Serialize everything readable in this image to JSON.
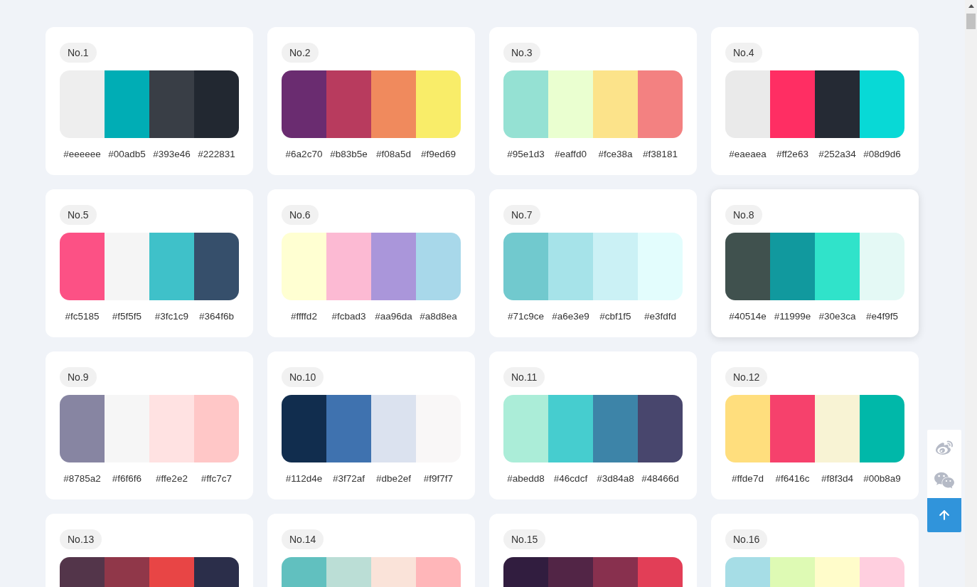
{
  "palettes": [
    {
      "label": "No.1",
      "highlighted": false,
      "swatches": [
        {
          "color": "#eeeeee",
          "hex": "#eeeeee"
        },
        {
          "color": "#00adb5",
          "hex": "#00adb5"
        },
        {
          "color": "#393e46",
          "hex": "#393e46"
        },
        {
          "color": "#222831",
          "hex": "#222831"
        }
      ]
    },
    {
      "label": "No.2",
      "highlighted": false,
      "swatches": [
        {
          "color": "#6a2c70",
          "hex": "#6a2c70"
        },
        {
          "color": "#b83b5e",
          "hex": "#b83b5e"
        },
        {
          "color": "#f08a5d",
          "hex": "#f08a5d"
        },
        {
          "color": "#f9ed69",
          "hex": "#f9ed69"
        }
      ]
    },
    {
      "label": "No.3",
      "highlighted": false,
      "swatches": [
        {
          "color": "#95e1d3",
          "hex": "#95e1d3"
        },
        {
          "color": "#eaffd0",
          "hex": "#eaffd0"
        },
        {
          "color": "#fce38a",
          "hex": "#fce38a"
        },
        {
          "color": "#f38181",
          "hex": "#f38181"
        }
      ]
    },
    {
      "label": "No.4",
      "highlighted": false,
      "swatches": [
        {
          "color": "#eaeaea",
          "hex": "#eaeaea"
        },
        {
          "color": "#ff2e63",
          "hex": "#ff2e63"
        },
        {
          "color": "#252a34",
          "hex": "#252a34"
        },
        {
          "color": "#08d9d6",
          "hex": "#08d9d6"
        }
      ]
    },
    {
      "label": "No.5",
      "highlighted": false,
      "swatches": [
        {
          "color": "#fc5185",
          "hex": "#fc5185"
        },
        {
          "color": "#f5f5f5",
          "hex": "#f5f5f5"
        },
        {
          "color": "#3fc1c9",
          "hex": "#3fc1c9"
        },
        {
          "color": "#364f6b",
          "hex": "#364f6b"
        }
      ]
    },
    {
      "label": "No.6",
      "highlighted": false,
      "swatches": [
        {
          "color": "#ffffd2",
          "hex": "#ffffd2"
        },
        {
          "color": "#fcbad3",
          "hex": "#fcbad3"
        },
        {
          "color": "#aa96da",
          "hex": "#aa96da"
        },
        {
          "color": "#a8d8ea",
          "hex": "#a8d8ea"
        }
      ]
    },
    {
      "label": "No.7",
      "highlighted": false,
      "swatches": [
        {
          "color": "#71c9ce",
          "hex": "#71c9ce"
        },
        {
          "color": "#a6e3e9",
          "hex": "#a6e3e9"
        },
        {
          "color": "#cbf1f5",
          "hex": "#cbf1f5"
        },
        {
          "color": "#e3fdfd",
          "hex": "#e3fdfd"
        }
      ]
    },
    {
      "label": "No.8",
      "highlighted": true,
      "swatches": [
        {
          "color": "#40514e",
          "hex": "#40514e"
        },
        {
          "color": "#11999e",
          "hex": "#11999e"
        },
        {
          "color": "#30e3ca",
          "hex": "#30e3ca"
        },
        {
          "color": "#e4f9f5",
          "hex": "#e4f9f5"
        }
      ]
    },
    {
      "label": "No.9",
      "highlighted": false,
      "swatches": [
        {
          "color": "#8785a2",
          "hex": "#8785a2"
        },
        {
          "color": "#f6f6f6",
          "hex": "#f6f6f6"
        },
        {
          "color": "#ffe2e2",
          "hex": "#ffe2e2"
        },
        {
          "color": "#ffc7c7",
          "hex": "#ffc7c7"
        }
      ]
    },
    {
      "label": "No.10",
      "highlighted": false,
      "swatches": [
        {
          "color": "#112d4e",
          "hex": "#112d4e"
        },
        {
          "color": "#3f72af",
          "hex": "#3f72af"
        },
        {
          "color": "#dbe2ef",
          "hex": "#dbe2ef"
        },
        {
          "color": "#f9f7f7",
          "hex": "#f9f7f7"
        }
      ]
    },
    {
      "label": "No.11",
      "highlighted": false,
      "swatches": [
        {
          "color": "#abedd8",
          "hex": "#abedd8"
        },
        {
          "color": "#46cdcf",
          "hex": "#46cdcf"
        },
        {
          "color": "#3d84a8",
          "hex": "#3d84a8"
        },
        {
          "color": "#48466d",
          "hex": "#48466d"
        }
      ]
    },
    {
      "label": "No.12",
      "highlighted": false,
      "swatches": [
        {
          "color": "#ffde7d",
          "hex": "#ffde7d"
        },
        {
          "color": "#f6416c",
          "hex": "#f6416c"
        },
        {
          "color": "#f8f3d4",
          "hex": "#f8f3d4"
        },
        {
          "color": "#00b8a9",
          "hex": "#00b8a9"
        }
      ]
    },
    {
      "label": "No.13",
      "highlighted": false,
      "swatches": [
        {
          "color": "#53354a"
        },
        {
          "color": "#903749"
        },
        {
          "color": "#e84545"
        },
        {
          "color": "#2b2e4a"
        }
      ]
    },
    {
      "label": "No.14",
      "highlighted": false,
      "swatches": [
        {
          "color": "#61c0bf"
        },
        {
          "color": "#bbded6"
        },
        {
          "color": "#fae3d9"
        },
        {
          "color": "#ffb6b9"
        }
      ]
    },
    {
      "label": "No.15",
      "highlighted": false,
      "swatches": [
        {
          "color": "#311d3f"
        },
        {
          "color": "#522546"
        },
        {
          "color": "#88304e"
        },
        {
          "color": "#e23e57"
        }
      ]
    },
    {
      "label": "No.16",
      "highlighted": false,
      "swatches": [
        {
          "color": "#a6dde6"
        },
        {
          "color": "#defab4"
        },
        {
          "color": "#fffcca"
        },
        {
          "color": "#ffcfdf"
        }
      ]
    }
  ]
}
